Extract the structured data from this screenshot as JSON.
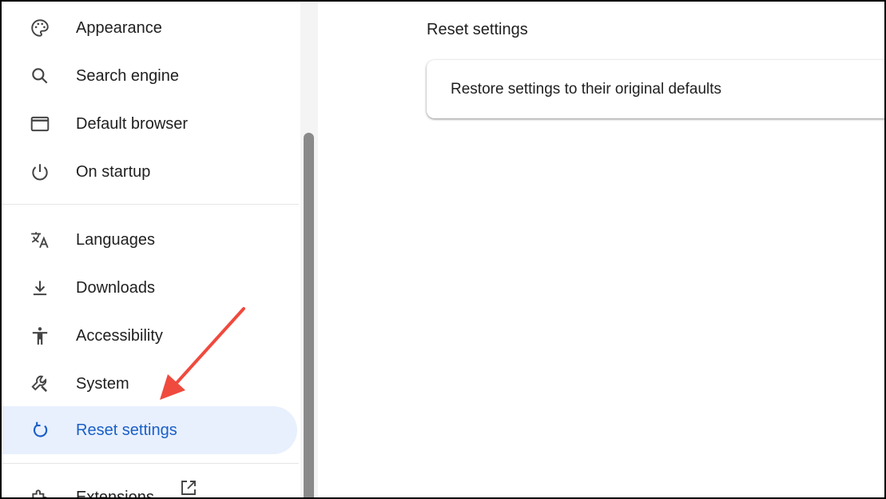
{
  "sidebar": {
    "items": [
      {
        "label": "Appearance",
        "icon": "palette-icon"
      },
      {
        "label": "Search engine",
        "icon": "search-icon"
      },
      {
        "label": "Default browser",
        "icon": "browser-window-icon"
      },
      {
        "label": "On startup",
        "icon": "power-icon"
      },
      {
        "label": "Languages",
        "icon": "translate-icon"
      },
      {
        "label": "Downloads",
        "icon": "download-icon"
      },
      {
        "label": "Accessibility",
        "icon": "accessibility-icon"
      },
      {
        "label": "System",
        "icon": "wrench-icon"
      },
      {
        "label": "Reset settings",
        "icon": "reset-icon",
        "active": true
      },
      {
        "label": "Extensions",
        "icon": "puzzle-icon"
      }
    ]
  },
  "main": {
    "section_title": "Reset settings",
    "card_label": "Restore settings to their original defaults"
  },
  "colors": {
    "active_bg": "#e8f0fe",
    "active_text": "#1a5fc7",
    "annotation_arrow": "#f04a3e"
  }
}
